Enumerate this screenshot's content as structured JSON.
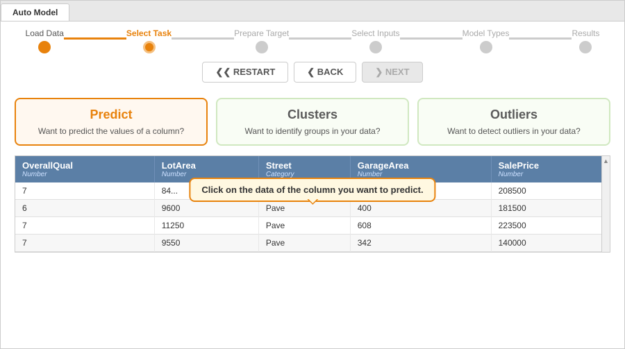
{
  "window": {
    "tab": "Auto Model"
  },
  "stepper": {
    "steps": [
      {
        "label": "Load Data",
        "state": "completed"
      },
      {
        "label": "Select Task",
        "state": "active"
      },
      {
        "label": "Prepare Target",
        "state": "inactive"
      },
      {
        "label": "Select Inputs",
        "state": "inactive"
      },
      {
        "label": "Model Types",
        "state": "inactive"
      },
      {
        "label": "Results",
        "state": "inactive"
      }
    ],
    "connectors": [
      "completed",
      "completed",
      "inactive",
      "inactive",
      "inactive"
    ]
  },
  "nav": {
    "restart_label": "❮❮ RESTART",
    "back_label": "❮ BACK",
    "next_label": "❯ NEXT"
  },
  "task_cards": [
    {
      "id": "predict",
      "title": "Predict",
      "description": "Want to predict the values of a column?",
      "selected": true
    },
    {
      "id": "clusters",
      "title": "Clusters",
      "description": "Want to identify groups in your data?",
      "selected": false
    },
    {
      "id": "outliers",
      "title": "Outliers",
      "description": "Want to detect outliers in your data?",
      "selected": false
    }
  ],
  "table": {
    "columns": [
      {
        "name": "OverallQual",
        "type": "Number"
      },
      {
        "name": "LotArea",
        "type": "Number"
      },
      {
        "name": "Street",
        "type": "Category"
      },
      {
        "name": "GarageArea",
        "type": "Number"
      },
      {
        "name": "SalePrice",
        "type": "Number"
      }
    ],
    "rows": [
      [
        "7",
        "84...",
        "",
        "208500"
      ],
      [
        "6",
        "9600",
        "Pave",
        "400",
        "181500"
      ],
      [
        "7",
        "11250",
        "Pave",
        "608",
        "223500"
      ],
      [
        "7",
        "9550",
        "Pave",
        "342",
        "140000"
      ]
    ],
    "tooltip": "Click on the data of the column you want to predict."
  }
}
